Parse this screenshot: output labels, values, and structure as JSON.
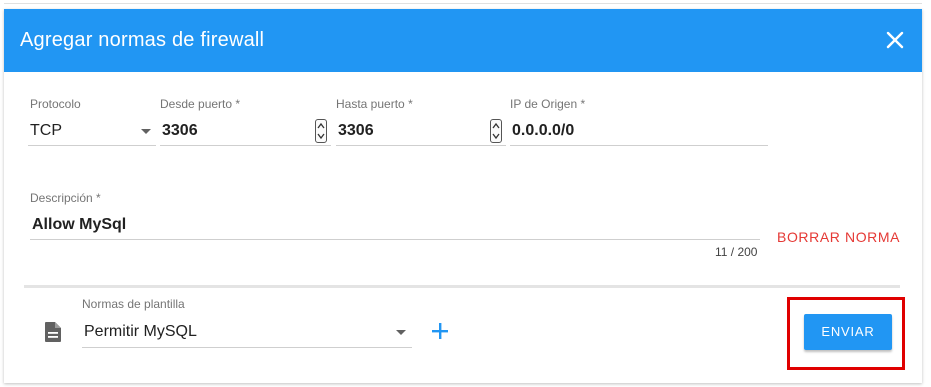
{
  "dialog": {
    "title": "Agregar normas de firewall",
    "close_icon": "close-icon"
  },
  "fields": {
    "protocol": {
      "label": "Protocolo",
      "value": "TCP"
    },
    "from_port": {
      "label": "Desde puerto",
      "required_mark": "*",
      "value": "3306"
    },
    "to_port": {
      "label": "Hasta puerto",
      "required_mark": "*",
      "value": "3306"
    },
    "source_ip": {
      "label": "IP de Origen",
      "required_mark": "*",
      "value": "0.0.0.0/0"
    },
    "description": {
      "label": "Descripción",
      "required_mark": "*",
      "value": "Allow MySql",
      "counter": "11 / 200"
    }
  },
  "actions": {
    "delete_rule": "BORRAR NORMA",
    "submit": "ENVIAR"
  },
  "template": {
    "label": "Normas de plantilla",
    "value": "Permitir MySQL",
    "icon": "document-icon",
    "add_icon": "plus-icon"
  },
  "colors": {
    "header": "#2196f3",
    "accent": "#2196f3",
    "danger": "#e53935",
    "highlight": "#e00000"
  }
}
